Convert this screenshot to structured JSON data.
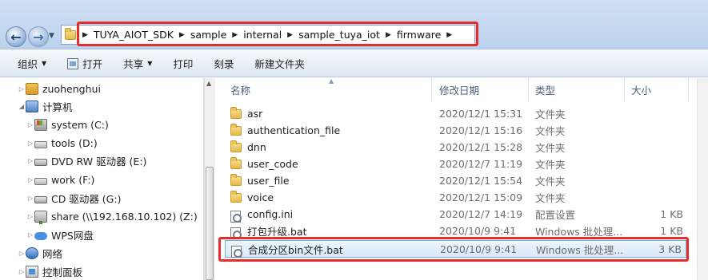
{
  "address": {
    "breadcrumbs": [
      "TUYA_AIOT_SDK",
      "sample",
      "internal",
      "sample_tuya_iot",
      "firmware"
    ]
  },
  "toolbar": {
    "organize": "组织",
    "open": "打开",
    "share": "共享",
    "print": "打印",
    "burn": "刻录",
    "new_folder": "新建文件夹"
  },
  "nav": {
    "items": [
      {
        "label": "zuohenghui",
        "icon": "user-folder-icon"
      },
      {
        "label": "计算机",
        "icon": "computer-icon"
      },
      {
        "label": "system (C:)",
        "icon": "system-drive-icon"
      },
      {
        "label": "tools (D:)",
        "icon": "drive-icon"
      },
      {
        "label": "DVD RW 驱动器 (E:)",
        "icon": "dvd-drive-icon"
      },
      {
        "label": "work (F:)",
        "icon": "drive-icon"
      },
      {
        "label": "CD 驱动器 (G:)",
        "icon": "cd-drive-icon"
      },
      {
        "label": "share (\\\\192.168.10.102) (Z:)",
        "icon": "network-drive-icon"
      },
      {
        "label": "WPS网盘",
        "icon": "cloud-icon"
      },
      {
        "label": "网络",
        "icon": "network-icon"
      },
      {
        "label": "控制面板",
        "icon": "control-panel-icon"
      }
    ]
  },
  "columns": {
    "name": "名称",
    "date": "修改日期",
    "type": "类型",
    "size": "大小"
  },
  "files": [
    {
      "name": "asr",
      "date": "2020/12/1 15:31",
      "type": "文件夹",
      "size": "",
      "kind": "folder"
    },
    {
      "name": "authentication_file",
      "date": "2020/12/1 15:16",
      "type": "文件夹",
      "size": "",
      "kind": "folder"
    },
    {
      "name": "dnn",
      "date": "2020/12/1 15:28",
      "type": "文件夹",
      "size": "",
      "kind": "folder"
    },
    {
      "name": "user_code",
      "date": "2020/12/7 11:19",
      "type": "文件夹",
      "size": "",
      "kind": "folder"
    },
    {
      "name": "user_file",
      "date": "2020/12/1 15:54",
      "type": "文件夹",
      "size": "",
      "kind": "folder"
    },
    {
      "name": "voice",
      "date": "2020/12/1 15:09",
      "type": "文件夹",
      "size": "",
      "kind": "folder"
    },
    {
      "name": "config.ini",
      "date": "2020/12/7 14:19",
      "type": "配置设置",
      "size": "1 KB",
      "kind": "file"
    },
    {
      "name": "打包升级.bat",
      "date": "2020/10/9 9:41",
      "type": "Windows 批处理...",
      "size": "1 KB",
      "kind": "file"
    },
    {
      "name": "合成分区bin文件.bat",
      "date": "2020/10/9 9:41",
      "type": "Windows 批处理...",
      "size": "3 KB",
      "kind": "file"
    }
  ]
}
